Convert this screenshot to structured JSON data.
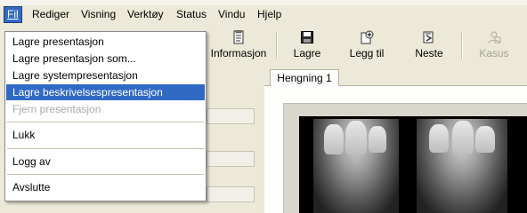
{
  "menubar": {
    "items": [
      {
        "label": "Fil"
      },
      {
        "label": "Rediger"
      },
      {
        "label": "Visning"
      },
      {
        "label": "Verktøy"
      },
      {
        "label": "Status"
      },
      {
        "label": "Vindu"
      },
      {
        "label": "Hjelp"
      }
    ]
  },
  "toolbar": {
    "buttons": [
      {
        "label": "Informasjon",
        "icon": "info-document-icon"
      },
      {
        "label": "Lagre",
        "icon": "floppy-disk-icon"
      },
      {
        "label": "Legg til",
        "icon": "add-icon"
      },
      {
        "label": "Neste",
        "icon": "next-icon"
      },
      {
        "label": "Kasus",
        "icon": "case-icon",
        "disabled": true
      }
    ]
  },
  "tab": {
    "label": "Hengning 1"
  },
  "file_menu": {
    "items": [
      {
        "label": "Lagre presentasjon"
      },
      {
        "label": "Lagre presentasjon som..."
      },
      {
        "label": "Lagre systempresentasjon"
      },
      {
        "label": "Lagre beskrivelsespresentasjon",
        "selected": true
      },
      {
        "label": "Fjern presentasjon",
        "disabled": true
      },
      {
        "label": "Lukk"
      },
      {
        "label": "Logg av"
      },
      {
        "label": "Avslutte"
      }
    ]
  },
  "colors": {
    "selection": "#316ac5",
    "background": "#ece9d8"
  }
}
